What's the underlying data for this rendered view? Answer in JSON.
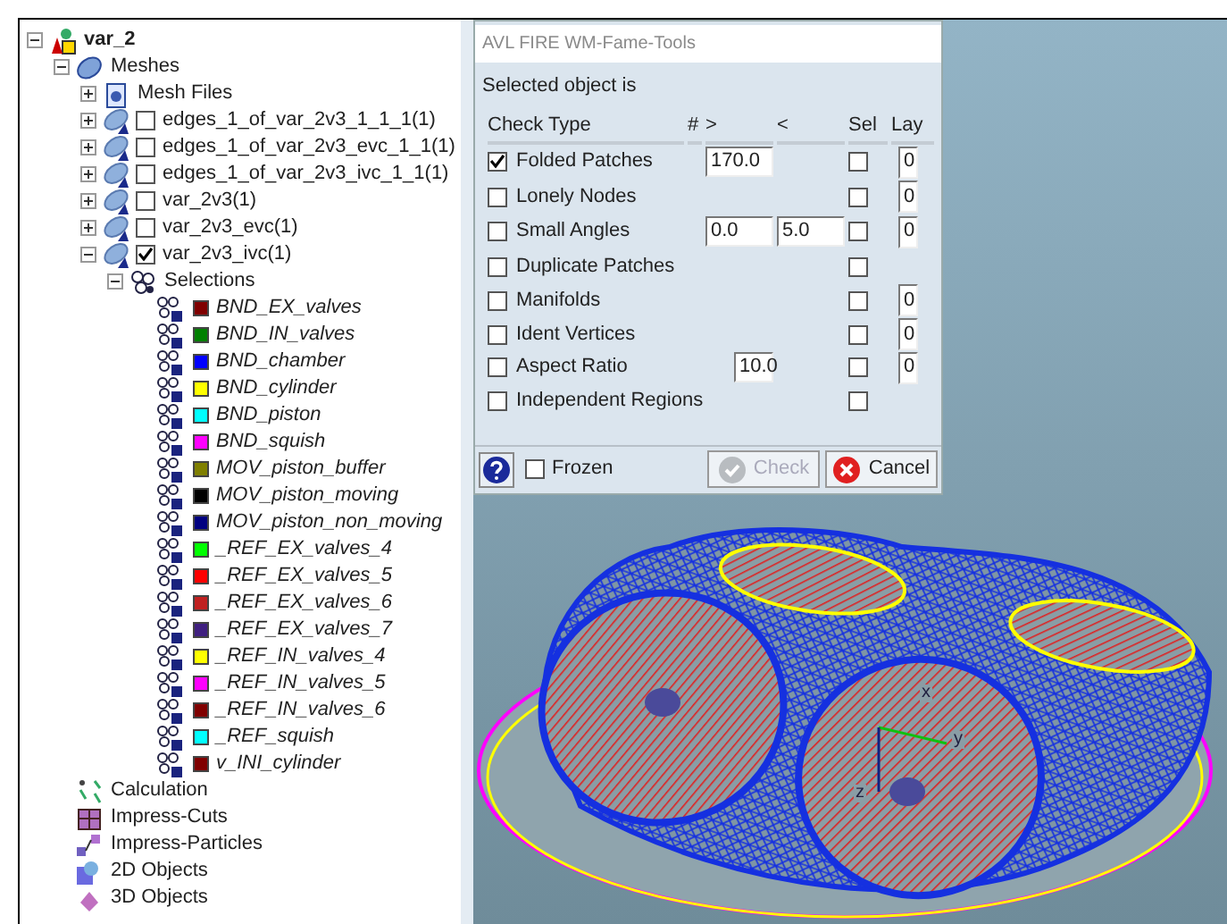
{
  "tree": [
    {
      "kind": "root",
      "label": "var_2",
      "expanded": true,
      "children": [
        {
          "kind": "meshes",
          "label": "Meshes",
          "expanded": true,
          "children": [
            {
              "kind": "files",
              "label": "Mesh Files",
              "expanded": false
            },
            {
              "kind": "mesh",
              "label": "edges_1_of_var_2v3_1_1_1(1)",
              "expanded": false,
              "checked": false
            },
            {
              "kind": "mesh",
              "label": "edges_1_of_var_2v3_evc_1_1(1)",
              "expanded": false,
              "checked": false
            },
            {
              "kind": "mesh",
              "label": "edges_1_of_var_2v3_ivc_1_1(1)",
              "expanded": false,
              "checked": false
            },
            {
              "kind": "mesh",
              "label": "var_2v3(1)",
              "expanded": false,
              "checked": false
            },
            {
              "kind": "mesh",
              "label": "var_2v3_evc(1)",
              "expanded": false,
              "checked": false
            },
            {
              "kind": "mesh",
              "label": "var_2v3_ivc(1)",
              "expanded": true,
              "checked": true,
              "children": [
                {
                  "kind": "selections",
                  "label": "Selections",
                  "expanded": true,
                  "children": [
                    {
                      "kind": "selection",
                      "label": "BND_EX_valves",
                      "color": "#800000"
                    },
                    {
                      "kind": "selection",
                      "label": "BND_IN_valves",
                      "color": "#008000"
                    },
                    {
                      "kind": "selection",
                      "label": "BND_chamber",
                      "color": "#0000ff"
                    },
                    {
                      "kind": "selection",
                      "label": "BND_cylinder",
                      "color": "#ffff00"
                    },
                    {
                      "kind": "selection",
                      "label": "BND_piston",
                      "color": "#00ffff"
                    },
                    {
                      "kind": "selection",
                      "label": "BND_squish",
                      "color": "#ff00ff"
                    },
                    {
                      "kind": "selection",
                      "label": "MOV_piston_buffer",
                      "color": "#808000"
                    },
                    {
                      "kind": "selection",
                      "label": "MOV_piston_moving",
                      "color": "#000000"
                    },
                    {
                      "kind": "selection",
                      "label": "MOV_piston_non_moving",
                      "color": "#000080"
                    },
                    {
                      "kind": "selection",
                      "label": "_REF_EX_valves_4",
                      "color": "#00ff00"
                    },
                    {
                      "kind": "selection",
                      "label": "_REF_EX_valves_5",
                      "color": "#ff0000"
                    },
                    {
                      "kind": "selection",
                      "label": "_REF_EX_valves_6",
                      "color": "#c02020"
                    },
                    {
                      "kind": "selection",
                      "label": "_REF_EX_valves_7",
                      "color": "#402080"
                    },
                    {
                      "kind": "selection",
                      "label": "_REF_IN_valves_4",
                      "color": "#ffff00"
                    },
                    {
                      "kind": "selection",
                      "label": "_REF_IN_valves_5",
                      "color": "#ff00ff"
                    },
                    {
                      "kind": "selection",
                      "label": "_REF_IN_valves_6",
                      "color": "#800000"
                    },
                    {
                      "kind": "selection",
                      "label": "_REF_squish",
                      "color": "#00ffff"
                    },
                    {
                      "kind": "selection",
                      "label": "v_INI_cylinder",
                      "color": "#800000"
                    }
                  ]
                }
              ]
            }
          ]
        },
        {
          "kind": "calculation",
          "label": "Calculation"
        },
        {
          "kind": "cuts",
          "label": "Impress-Cuts"
        },
        {
          "kind": "particles",
          "label": "Impress-Particles"
        },
        {
          "kind": "objects2d",
          "label": "2D Objects"
        },
        {
          "kind": "objects3d",
          "label": "3D Objects"
        }
      ]
    }
  ],
  "dialog": {
    "title": "AVL FIRE WM-Fame-Tools",
    "subtitle": "Selected object is",
    "columns": [
      "Check Type",
      "#",
      ">",
      "<",
      "Sel",
      "Lay"
    ],
    "rows": [
      {
        "kind": "wide",
        "label": "Folded Patches",
        "checked": true,
        "gt": "170.0",
        "sel": false,
        "lay": "0"
      },
      {
        "label": "Lonely Nodes",
        "checked": false,
        "sel": false,
        "lay": "0"
      },
      {
        "kind": "wide",
        "label": "Small Angles",
        "checked": false,
        "gt": "0.0",
        "lt": "5.0",
        "sel": false,
        "lay": "0"
      },
      {
        "label": "Duplicate Patches",
        "checked": false,
        "sel": false
      },
      {
        "label": "Manifolds",
        "checked": false,
        "sel": false,
        "lay": "0"
      },
      {
        "label": "Ident Vertices",
        "checked": false,
        "sel": false,
        "lay": "0"
      },
      {
        "kind": "narrow",
        "label": "Aspect Ratio",
        "checked": false,
        "gt": "10.0",
        "sel": false,
        "lay": "0"
      },
      {
        "label": "Independent Regions",
        "checked": false,
        "sel": false
      }
    ],
    "frozen": {
      "label": "Frozen",
      "checked": false
    },
    "buttons": [
      {
        "kind": "check",
        "label": "Check",
        "disabled": true
      },
      {
        "kind": "cancel",
        "label": "Cancel",
        "disabled": false
      }
    ]
  },
  "viewport": {
    "axis_labels": [
      "x",
      "y",
      "z"
    ]
  }
}
